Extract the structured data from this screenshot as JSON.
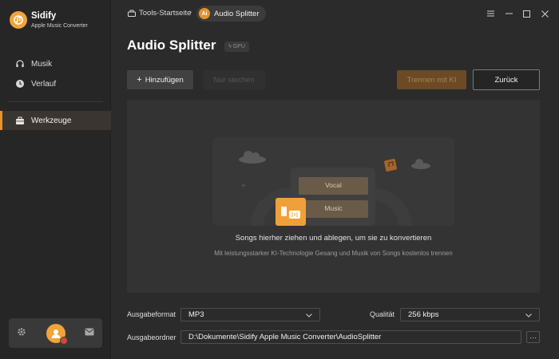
{
  "app": {
    "name": "Sidify",
    "subtitle": "Apple Music Converter"
  },
  "sidebar": {
    "items": [
      {
        "label": "Musik",
        "icon": "headphones-icon"
      },
      {
        "label": "Verlauf",
        "icon": "clock-icon"
      },
      {
        "label": "Werkzeuge",
        "icon": "toolbox-icon",
        "active": true
      }
    ]
  },
  "breadcrumb": {
    "home": "Tools-Startseite",
    "current_badge": "Ai",
    "current": "Audio Splitter"
  },
  "page": {
    "title": "Audio Splitter",
    "badge": "GPU"
  },
  "toolbar": {
    "add_label": "Hinzufügen",
    "edit_label": "Nur stechen",
    "split_label": "Trennen mit KI",
    "back_label": "Zurück"
  },
  "dropzone": {
    "pill_vocal": "Vocal",
    "pill_music": "Music",
    "title": "Songs hierher ziehen und ablegen, um sie zu konvertieren",
    "subtitle": "Mit leistungsstarker KI-Technologie Gesang und Musik von Songs kostenlos trennen"
  },
  "settings": {
    "format_label": "Ausgabeformat",
    "format_value": "MP3",
    "quality_label": "Qualität",
    "quality_value": "256 kbps",
    "folder_label": "Ausgabeordner",
    "folder_value": "D:\\Dokumente\\Sidify Apple Music Converter\\AudioSplitter",
    "more_label": "···"
  },
  "colors": {
    "accent": "#e8922b",
    "background": "#2b2b2b",
    "sidebar": "#262626",
    "panel": "#333333"
  }
}
